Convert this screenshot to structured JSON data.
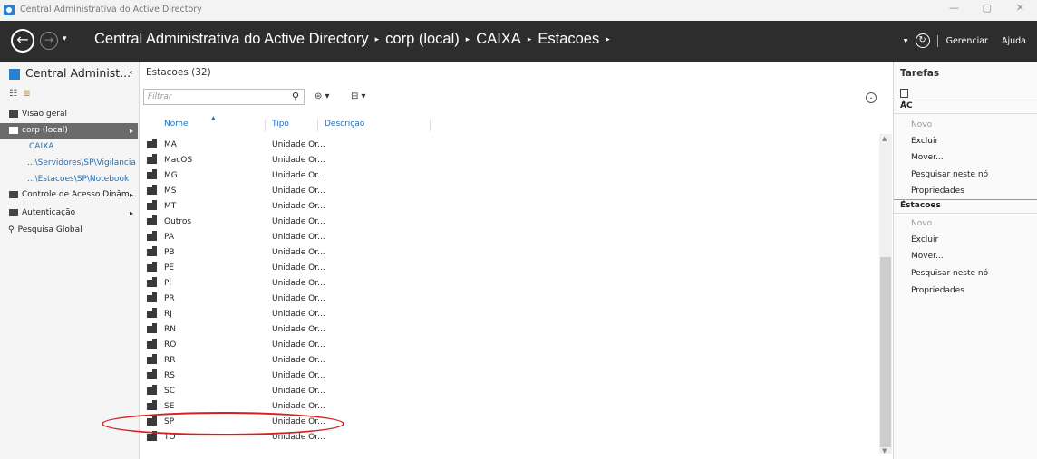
{
  "window": {
    "title": "Central Administrativa do Active Directory",
    "min": "—",
    "restore": "▢",
    "close": "✕"
  },
  "header": {
    "back_glyph": "←",
    "forward_glyph": "→",
    "history_glyph": "▾",
    "breadcrumb": [
      "Central Administrativa do Active Directory",
      "corp (local)",
      "CAIXA",
      "Estacoes"
    ],
    "separator": "▸",
    "refresh_dropdown": "▾",
    "refresh_glyph": "↻",
    "manage": "Gerenciar",
    "help": "Ajuda"
  },
  "left": {
    "header": "Central Administ...",
    "collapse": "‹",
    "list_view_glyph": "☷",
    "tree_view_glyph": "≣",
    "items": [
      {
        "label": "Visão geral"
      },
      {
        "label": "corp (local)"
      },
      {
        "label": "Controle de Acesso Dinâm..."
      },
      {
        "label": "Autenticação"
      },
      {
        "label": "Pesquisa Global"
      }
    ],
    "arrow": "▸",
    "search_glyph": "⚲",
    "subitems": [
      "CAIXA",
      "...\\Servidores\\SP\\Vigilancia",
      "...\\Estacoes\\SP\\Notebook"
    ]
  },
  "middle": {
    "title": "Estacoes  (32)",
    "filter_placeholder": "Filtrar",
    "search_glyph": "⚲",
    "view_btn": "⊜ ▾",
    "save_btn": "⊟ ▾",
    "expand_glyph": "⌄",
    "sort_glyph": "▲",
    "columns": [
      "Nome",
      "Tipo",
      "Descrição"
    ],
    "type_text": "Unidade Or...",
    "rows": [
      "MA",
      "MacOS",
      "MG",
      "MS",
      "MT",
      "Outros",
      "PA",
      "PB",
      "PE",
      "PI",
      "PR",
      "RJ",
      "RN",
      "RO",
      "RR",
      "RS",
      "SC",
      "SE",
      "SP",
      "TO"
    ],
    "scroll_up": "▲",
    "scroll_down": "▼"
  },
  "right": {
    "title": "Tarefas",
    "caret": "⌃",
    "sections": [
      {
        "label": "AC",
        "actions": [
          "Novo",
          "Excluir",
          "Mover...",
          "Pesquisar neste nó",
          "Propriedades"
        ]
      },
      {
        "label": "Estacoes",
        "actions": [
          "Novo",
          "Excluir",
          "Mover...",
          "Pesquisar neste nó",
          "Propriedades"
        ]
      }
    ]
  },
  "colors": {
    "header_bg": "#2d2d2d",
    "selection": "#6b6b6b",
    "link": "#1e6fbd",
    "annotation": "#d42020"
  }
}
